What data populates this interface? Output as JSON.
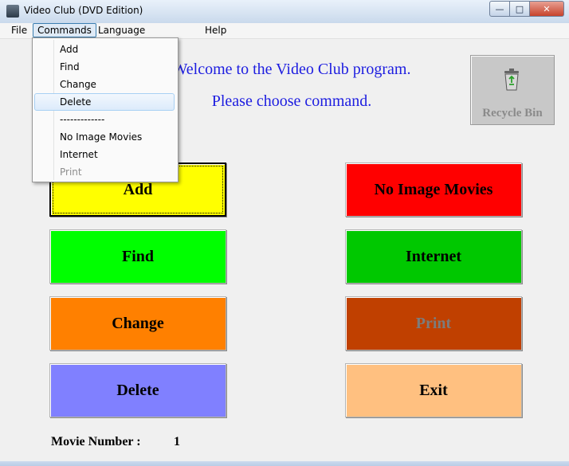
{
  "window": {
    "title": "Video Club (DVD Edition)",
    "controls": {
      "minimize": "—",
      "maximize": "□",
      "close": "✕"
    }
  },
  "menubar": {
    "items": [
      {
        "label": "File"
      },
      {
        "label": "Commands"
      },
      {
        "label": "Language"
      },
      {
        "label": "Help"
      }
    ]
  },
  "dropdown": {
    "items": [
      {
        "label": "Add",
        "state": "normal"
      },
      {
        "label": "Find",
        "state": "normal"
      },
      {
        "label": "Change",
        "state": "normal"
      },
      {
        "label": "Delete",
        "state": "hover"
      },
      {
        "label": "-------------",
        "state": "separator"
      },
      {
        "label": "No Image Movies",
        "state": "normal"
      },
      {
        "label": "Internet",
        "state": "normal"
      },
      {
        "label": "Print",
        "state": "disabled"
      }
    ]
  },
  "main": {
    "welcome": "Welcome to the Video Club program.",
    "prompt": "Please choose command.",
    "recycle_bin": {
      "label": "Recycle Bin",
      "icon": "recycle-bin-icon"
    },
    "buttons": [
      {
        "label": "Add",
        "color": "#ffff00",
        "enabled": true
      },
      {
        "label": "No Image Movies",
        "color": "#ff0000",
        "enabled": true
      },
      {
        "label": "Find",
        "color": "#00ff00",
        "enabled": true
      },
      {
        "label": "Internet",
        "color": "#00c800",
        "enabled": true
      },
      {
        "label": "Change",
        "color": "#ff8000",
        "enabled": true
      },
      {
        "label": "Print",
        "color": "#c04000",
        "enabled": false
      },
      {
        "label": "Delete",
        "color": "#8080ff",
        "enabled": true
      },
      {
        "label": "Exit",
        "color": "#ffc080",
        "enabled": true
      }
    ],
    "movie_number": {
      "label": "Movie Number :",
      "value": "1"
    }
  }
}
